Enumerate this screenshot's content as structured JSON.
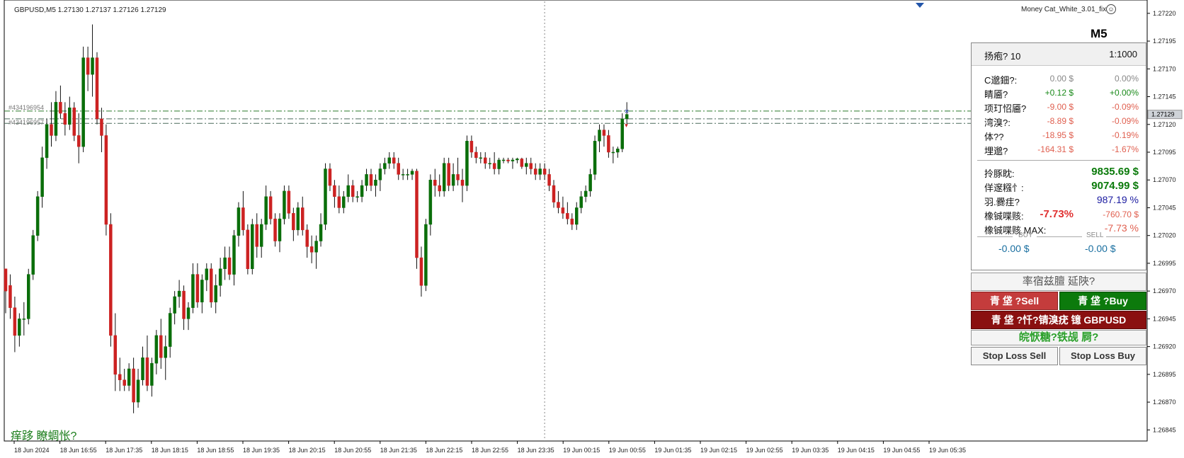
{
  "header": {
    "symbol_info": "GBPUSD,M5  1.27130 1.27137 1.27126 1.27129",
    "ea_name": "Money Cat_White_3.01_fix",
    "timeframe": "M5",
    "smiley": "☺"
  },
  "bottom_label": "痒跢 瞭蜩怅?",
  "order_lines": {
    "order1": "#434196954 ",
    "order2": "#434196957 "
  },
  "panel": {
    "header_left": "扬疱? 10",
    "header_right": "1:1000",
    "rows": [
      {
        "label": "C邈鈿?:",
        "value": "0.00 $",
        "pct": "0.00%",
        "color": "#888888"
      },
      {
        "label": "睛靥?",
        "value": "+0.12 $",
        "pct": "+0.00%",
        "color": "#1a8a1a"
      },
      {
        "label": "项玎怊靥?",
        "value": "-9.00 $",
        "pct": "-0.09%",
        "color": "#e06050"
      },
      {
        "label": "湾溴?:",
        "value": "-8.89 $",
        "pct": "-0.09%",
        "color": "#e06050"
      },
      {
        "label": "体??",
        "value": "-18.95 $",
        "pct": "-0.19%",
        "color": "#e06050"
      },
      {
        "label": "埋邈?",
        "value": "-164.31 $",
        "pct": "-1.67%",
        "color": "#e06050"
      }
    ],
    "balance_label": "拎豚眈:",
    "balance_value": "9835.69 $",
    "equity_label": "佯邃糨忄:",
    "equity_value": "9074.99 $",
    "margin_label": "羽.爨疰?",
    "margin_value": "987.19 %",
    "drawdown_label": "橡铖喋赅:",
    "drawdown_pct": "-7.73%",
    "drawdown_value": "-760.70 $",
    "drawdown_max_label": "橡铖喋赅 MAX:",
    "drawdown_max_value": "-7.73 %",
    "buy_label": "BUY",
    "sell_label": "SELL",
    "buy_value": "-0.00 $",
    "sell_value": "-0.00 $"
  },
  "buttons": {
    "status": "率宿兹膻 延陜?",
    "close_sell": "青 垡    ?Sell",
    "close_buy": "青 垡    ?Buy",
    "close_symbol": "青 垡    ?忏?锖溴疣 镱 GBPUSD",
    "pending": "皖恹糖?铁觇   屙?",
    "sl_sell": "Stop Loss Sell",
    "sl_buy": "Stop Loss Buy"
  },
  "chart_data": {
    "type": "candlestick",
    "symbol": "GBPUSD,M5",
    "ylim": [
      1.26835,
      1.27232
    ],
    "y_ticks": [
      1.2722,
      1.27195,
      1.2717,
      1.27145,
      1.2712,
      1.27095,
      1.2707,
      1.27045,
      1.2702,
      1.26995,
      1.2697,
      1.26945,
      1.2692,
      1.26895,
      1.2687,
      1.26845
    ],
    "current_price": 1.27129,
    "x_labels": [
      "18 Jun 2024",
      "18 Jun 16:55",
      "18 Jun 17:35",
      "18 Jun 18:15",
      "18 Jun 18:55",
      "18 Jun 19:35",
      "18 Jun 20:15",
      "18 Jun 20:55",
      "18 Jun 21:35",
      "18 Jun 22:15",
      "18 Jun 22:55",
      "18 Jun 23:35",
      "19 Jun 00:15",
      "19 Jun 00:55",
      "19 Jun 01:35",
      "19 Jun 02:15",
      "19 Jun 02:55",
      "19 Jun 03:35",
      "19 Jun 04:15",
      "19 Jun 04:55",
      "19 Jun 05:35"
    ],
    "order_levels": [
      1.27132,
      1.27125,
      1.27121
    ],
    "crosshair_bar_index": 118,
    "bullish_color": "#0a6e0a",
    "bearish_color": "#cc2222",
    "candles_ohlc": [
      [
        1.2699,
        1.2699,
        1.2695,
        1.2697
      ],
      [
        1.26975,
        1.26985,
        1.26945,
        1.26955
      ],
      [
        1.26955,
        1.26965,
        1.26915,
        1.2693
      ],
      [
        1.2693,
        1.2695,
        1.2692,
        1.26945
      ],
      [
        1.26945,
        1.2696,
        1.2693,
        1.26945
      ],
      [
        1.26945,
        1.2699,
        1.2694,
        1.26985
      ],
      [
        1.26985,
        1.27025,
        1.2698,
        1.2702
      ],
      [
        1.2702,
        1.2706,
        1.27015,
        1.27055
      ],
      [
        1.27055,
        1.271,
        1.27045,
        1.2709
      ],
      [
        1.2709,
        1.27125,
        1.2708,
        1.2712
      ],
      [
        1.2712,
        1.2714,
        1.271,
        1.2711
      ],
      [
        1.2711,
        1.2715,
        1.27105,
        1.2714
      ],
      [
        1.2714,
        1.27155,
        1.27125,
        1.2713
      ],
      [
        1.2713,
        1.2714,
        1.2711,
        1.2712
      ],
      [
        1.2712,
        1.27145,
        1.27115,
        1.27135
      ],
      [
        1.27135,
        1.2714,
        1.27105,
        1.2711
      ],
      [
        1.2711,
        1.2713,
        1.27085,
        1.271
      ],
      [
        1.271,
        1.2719,
        1.27095,
        1.2718
      ],
      [
        1.2718,
        1.2719,
        1.2715,
        1.27165
      ],
      [
        1.27165,
        1.2721,
        1.27145,
        1.2718
      ],
      [
        1.2718,
        1.27185,
        1.2712,
        1.27125
      ],
      [
        1.27125,
        1.27135,
        1.27095,
        1.2711
      ],
      [
        1.2711,
        1.2712,
        1.2702,
        1.2703
      ],
      [
        1.2703,
        1.2704,
        1.2692,
        1.2693
      ],
      [
        1.2693,
        1.2695,
        1.2688,
        1.26895
      ],
      [
        1.26895,
        1.2691,
        1.2688,
        1.2689
      ],
      [
        1.2689,
        1.269,
        1.2688,
        1.26885
      ],
      [
        1.26885,
        1.26905,
        1.2688,
        1.269
      ],
      [
        1.269,
        1.2691,
        1.2686,
        1.2687
      ],
      [
        1.2687,
        1.269,
        1.26865,
        1.2689
      ],
      [
        1.2689,
        1.2692,
        1.26885,
        1.2691
      ],
      [
        1.2691,
        1.2693,
        1.2688,
        1.26885
      ],
      [
        1.26885,
        1.2691,
        1.26875,
        1.26905
      ],
      [
        1.26905,
        1.26935,
        1.26895,
        1.2693
      ],
      [
        1.2693,
        1.26945,
        1.269,
        1.2691
      ],
      [
        1.2691,
        1.2693,
        1.2689,
        1.2692
      ],
      [
        1.2692,
        1.26955,
        1.2691,
        1.2695
      ],
      [
        1.2695,
        1.2697,
        1.2694,
        1.26965
      ],
      [
        1.26965,
        1.2698,
        1.26955,
        1.2697
      ],
      [
        1.2697,
        1.26975,
        1.26935,
        1.26945
      ],
      [
        1.26945,
        1.2696,
        1.26935,
        1.26955
      ],
      [
        1.26955,
        1.26995,
        1.2695,
        1.26985
      ],
      [
        1.26985,
        1.26995,
        1.26955,
        1.2696
      ],
      [
        1.2696,
        1.26985,
        1.2695,
        1.2698
      ],
      [
        1.2698,
        1.26995,
        1.2697,
        1.2699
      ],
      [
        1.2699,
        1.26995,
        1.26955,
        1.2696
      ],
      [
        1.2696,
        1.26985,
        1.2695,
        1.26975
      ],
      [
        1.26975,
        1.27,
        1.26965,
        1.2699
      ],
      [
        1.2699,
        1.2701,
        1.2698,
        1.27
      ],
      [
        1.27,
        1.2701,
        1.2698,
        1.26985
      ],
      [
        1.26985,
        1.27025,
        1.26975,
        1.2702
      ],
      [
        1.2702,
        1.2705,
        1.2701,
        1.27045
      ],
      [
        1.27045,
        1.2706,
        1.2702,
        1.27025
      ],
      [
        1.27025,
        1.2703,
        1.26985,
        1.2699
      ],
      [
        1.2699,
        1.27035,
        1.26985,
        1.2703
      ],
      [
        1.2703,
        1.2704,
        1.27,
        1.2701
      ],
      [
        1.2701,
        1.27035,
        1.27,
        1.2703
      ],
      [
        1.2703,
        1.27065,
        1.27025,
        1.27055
      ],
      [
        1.27055,
        1.2706,
        1.2703,
        1.27035
      ],
      [
        1.27035,
        1.2704,
        1.2701,
        1.27015
      ],
      [
        1.27015,
        1.2704,
        1.27005,
        1.27035
      ],
      [
        1.27035,
        1.27065,
        1.2703,
        1.2706
      ],
      [
        1.2706,
        1.27065,
        1.27035,
        1.2704
      ],
      [
        1.2704,
        1.27045,
        1.27015,
        1.27025
      ],
      [
        1.27025,
        1.2705,
        1.2702,
        1.27045
      ],
      [
        1.27045,
        1.27055,
        1.2702,
        1.27025
      ],
      [
        1.27025,
        1.2703,
        1.27,
        1.2701
      ],
      [
        1.2701,
        1.2702,
        1.26995,
        1.27005
      ],
      [
        1.27005,
        1.2702,
        1.2699,
        1.27015
      ],
      [
        1.27015,
        1.2704,
        1.2701,
        1.2703
      ],
      [
        1.2703,
        1.27085,
        1.27025,
        1.2708
      ],
      [
        1.2708,
        1.27085,
        1.2706,
        1.27065
      ],
      [
        1.27065,
        1.2707,
        1.27045,
        1.27055
      ],
      [
        1.27055,
        1.27065,
        1.2704,
        1.27045
      ],
      [
        1.27045,
        1.2706,
        1.2704,
        1.27055
      ],
      [
        1.27055,
        1.27075,
        1.2705,
        1.27065
      ],
      [
        1.27065,
        1.2707,
        1.2705,
        1.27055
      ],
      [
        1.27055,
        1.2706,
        1.2705,
        1.27055
      ],
      [
        1.27055,
        1.2707,
        1.2705,
        1.27065
      ],
      [
        1.27065,
        1.2708,
        1.2706,
        1.27075
      ],
      [
        1.27075,
        1.2708,
        1.2706,
        1.27065
      ],
      [
        1.27065,
        1.27075,
        1.27055,
        1.2707
      ],
      [
        1.2707,
        1.27085,
        1.2706,
        1.2708
      ],
      [
        1.2708,
        1.2709,
        1.27075,
        1.27085
      ],
      [
        1.27085,
        1.27095,
        1.2708,
        1.2709
      ],
      [
        1.2709,
        1.27095,
        1.2708,
        1.27085
      ],
      [
        1.27085,
        1.2709,
        1.2707,
        1.27075
      ],
      [
        1.27075,
        1.2708,
        1.2707,
        1.27075
      ],
      [
        1.27075,
        1.2708,
        1.2707,
        1.27075
      ],
      [
        1.27075,
        1.2708,
        1.2707,
        1.27078
      ],
      [
        1.27078,
        1.2708,
        1.2699,
        1.27
      ],
      [
        1.27,
        1.2701,
        1.26965,
        1.26975
      ],
      [
        1.26975,
        1.27035,
        1.2697,
        1.2703
      ],
      [
        1.2703,
        1.27075,
        1.2702,
        1.2707
      ],
      [
        1.2707,
        1.2708,
        1.27055,
        1.27065
      ],
      [
        1.27065,
        1.27075,
        1.27055,
        1.2706
      ],
      [
        1.2706,
        1.2709,
        1.27055,
        1.27085
      ],
      [
        1.27085,
        1.2709,
        1.2706,
        1.27065
      ],
      [
        1.27065,
        1.27085,
        1.2706,
        1.27075
      ],
      [
        1.27075,
        1.2709,
        1.27065,
        1.2707
      ],
      [
        1.2707,
        1.2708,
        1.2705,
        1.27065
      ],
      [
        1.27065,
        1.2711,
        1.2706,
        1.27105
      ],
      [
        1.27105,
        1.2711,
        1.2709,
        1.27095
      ],
      [
        1.27095,
        1.271,
        1.27085,
        1.2709
      ],
      [
        1.2709,
        1.27095,
        1.27085,
        1.2709
      ],
      [
        1.2709,
        1.27095,
        1.2708,
        1.27085
      ],
      [
        1.27085,
        1.2709,
        1.2708,
        1.27085
      ],
      [
        1.27085,
        1.27095,
        1.27075,
        1.2708
      ],
      [
        1.2708,
        1.2709,
        1.27075,
        1.27088
      ],
      [
        1.27088,
        1.2709,
        1.27085,
        1.27088
      ],
      [
        1.27088,
        1.2709,
        1.27085,
        1.27087
      ],
      [
        1.27087,
        1.2709,
        1.2708,
        1.27088
      ],
      [
        1.27088,
        1.2709,
        1.27085,
        1.27089
      ],
      [
        1.27089,
        1.2709,
        1.2708,
        1.27082
      ],
      [
        1.27082,
        1.2709,
        1.27075,
        1.27085
      ],
      [
        1.27085,
        1.2709,
        1.27075,
        1.2708
      ],
      [
        1.2708,
        1.27085,
        1.2707,
        1.27075
      ],
      [
        1.27075,
        1.27085,
        1.2707,
        1.2708
      ],
      [
        1.2708,
        1.27085,
        1.2707,
        1.27075
      ],
      [
        1.27075,
        1.2708,
        1.2706,
        1.27065
      ],
      [
        1.27065,
        1.2707,
        1.27045,
        1.2705
      ],
      [
        1.2705,
        1.2706,
        1.2704,
        1.27045
      ],
      [
        1.27045,
        1.27055,
        1.27035,
        1.2704
      ],
      [
        1.2704,
        1.2705,
        1.2703,
        1.27035
      ],
      [
        1.27035,
        1.2704,
        1.27025,
        1.2703
      ],
      [
        1.2703,
        1.2705,
        1.27025,
        1.27045
      ],
      [
        1.27045,
        1.2706,
        1.2704,
        1.27055
      ],
      [
        1.27055,
        1.27065,
        1.2705,
        1.2706
      ],
      [
        1.2706,
        1.2708,
        1.27055,
        1.27075
      ],
      [
        1.27075,
        1.2711,
        1.2707,
        1.27105
      ],
      [
        1.27105,
        1.2712,
        1.27095,
        1.27115
      ],
      [
        1.27115,
        1.2712,
        1.271,
        1.2711
      ],
      [
        1.2711,
        1.27115,
        1.2709,
        1.27095
      ],
      [
        1.27095,
        1.271,
        1.27085,
        1.27095
      ],
      [
        1.27095,
        1.271,
        1.2709,
        1.27098
      ],
      [
        1.27098,
        1.2713,
        1.27095,
        1.27125
      ],
      [
        1.27125,
        1.2714,
        1.2712,
        1.27129
      ]
    ]
  }
}
